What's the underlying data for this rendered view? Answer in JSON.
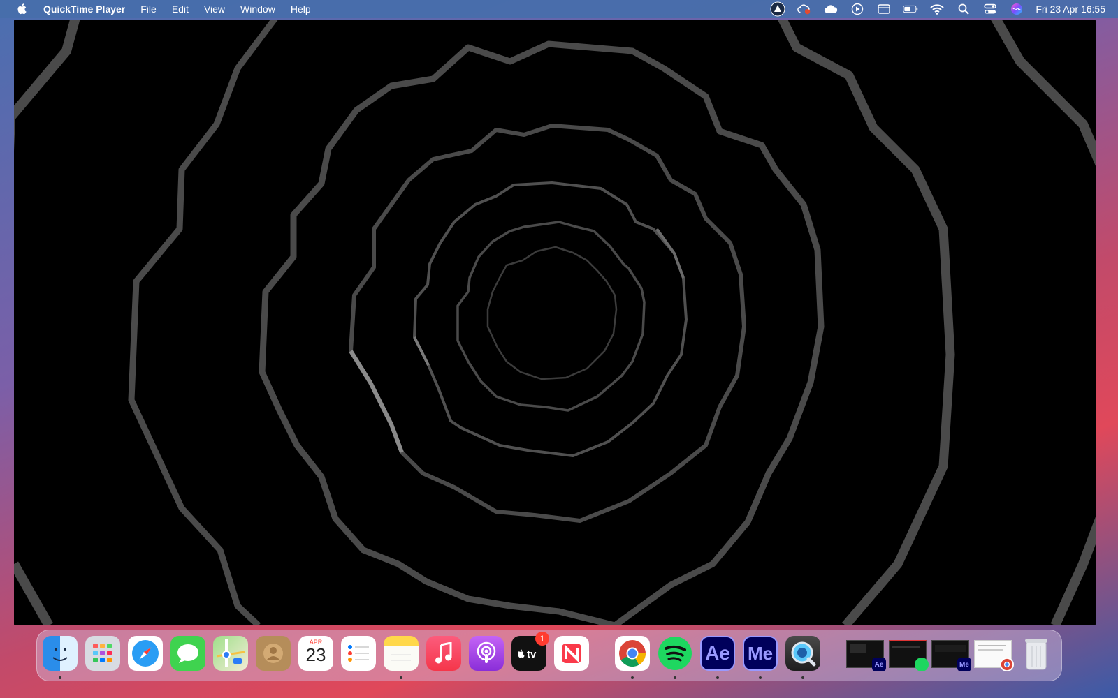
{
  "menubar": {
    "app_name": "QuickTime Player",
    "menus": [
      "File",
      "Edit",
      "View",
      "Window",
      "Help"
    ],
    "clock": "Fri 23 Apr  16:55"
  },
  "calendar": {
    "month": "APR",
    "day": "23"
  },
  "dock": {
    "apps": {
      "tv_badge": "1",
      "ae_label": "Ae",
      "me_label": "Me"
    },
    "windows": {
      "ae_label": "Ae",
      "me_label": "Me"
    }
  },
  "colors": {
    "menubar_bg": "#466eaa",
    "video_bg": "#000000",
    "ring_stroke": "#555555",
    "badge_red": "#ff3b30"
  }
}
